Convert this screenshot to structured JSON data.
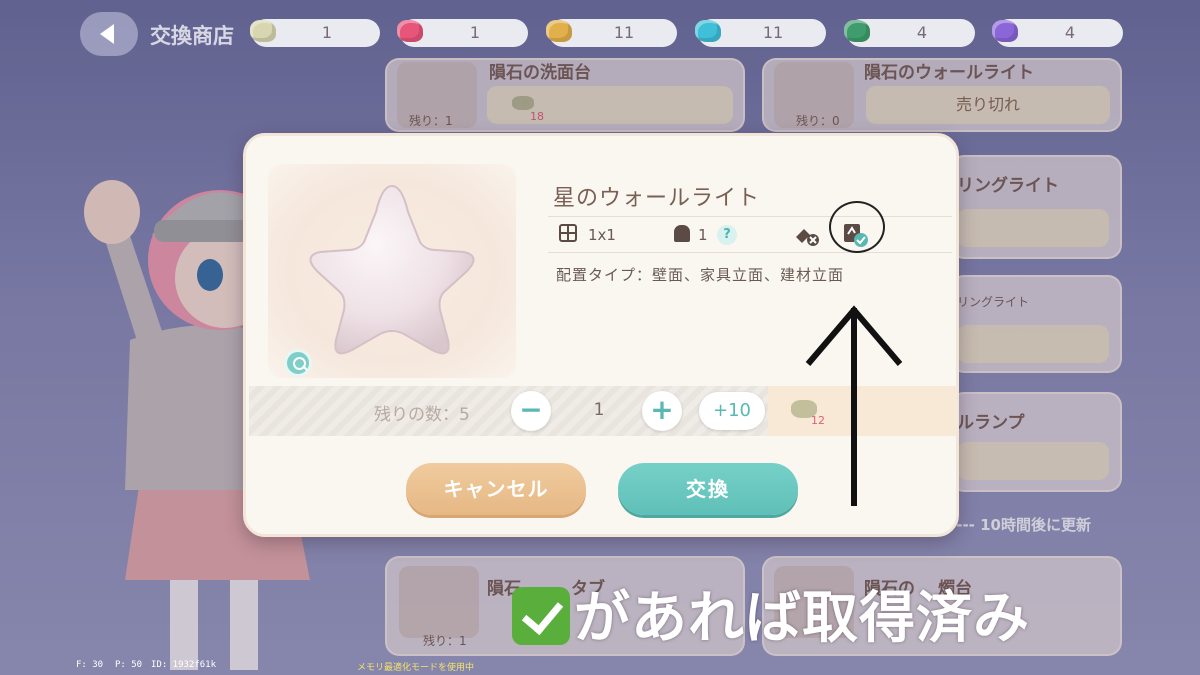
{
  "header": {
    "title": "交換商店"
  },
  "resources": [
    {
      "name": "gray-meteorite",
      "count": "1",
      "color": "#d8d6b0"
    },
    {
      "name": "pink-meteorite",
      "count": "1",
      "color": "#e8557a"
    },
    {
      "name": "gold-meteorite",
      "count": "11",
      "color": "#e2b04a"
    },
    {
      "name": "cyan-meteorite",
      "count": "11",
      "color": "#3fbfd8"
    },
    {
      "name": "green-meteorite",
      "count": "4",
      "color": "#3f9c6c"
    },
    {
      "name": "purple-meteorite",
      "count": "4",
      "color": "#8a66d8"
    }
  ],
  "shop_cards": [
    {
      "title": "隕石の洗面台",
      "remaining": "残り：1",
      "price": "18"
    },
    {
      "title": "隕石のウォールライト",
      "remaining": "残り：0",
      "button": "売り切れ"
    },
    {
      "title": "リングライト"
    },
    {
      "title": "リングライト"
    },
    {
      "title": "ルランプ"
    },
    {
      "title": "隕石",
      "title2": "タブ",
      "remaining": "残り：1"
    },
    {
      "title": "隕石の",
      "title2": "燭台"
    }
  ],
  "refresh_text": "---- 10時間後に更新",
  "dialog": {
    "item_name": "星のウォールライト",
    "size": "1x1",
    "people": "1",
    "help": "?",
    "placement": "配置タイプ：壁面、家具立面、建材立面",
    "remain_label": "残りの数：5",
    "quantity": "1",
    "minus": "−",
    "plus": "+",
    "plus10": "+10",
    "price": "12",
    "cancel_label": "キャンセル",
    "exchange_label": "交換"
  },
  "annotation": {
    "text": "があれば取得済み"
  },
  "debug": {
    "fps": "F: 30",
    "ping": "P: 50",
    "id": "ID: 1932f61k",
    "memory_mode": "メモリ最適化モードを使用中"
  }
}
